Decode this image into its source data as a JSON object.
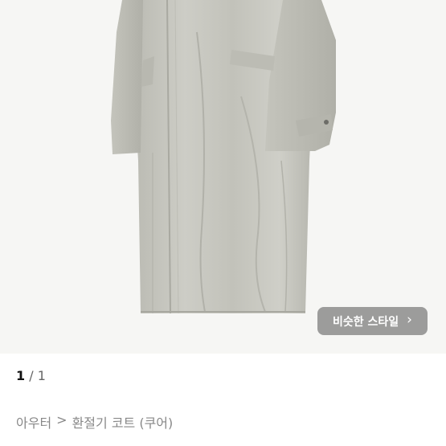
{
  "image": {
    "description_icon": "coat-photo",
    "background_color": "#f6f6f4",
    "coat_color": "#c7c7bf"
  },
  "similar_style": {
    "label": "비슷한 스타일",
    "icon": "chevron-right-icon"
  },
  "pagination": {
    "current": "1",
    "separator": "/",
    "total": "1"
  },
  "breadcrumb": {
    "category": "아우터",
    "separator": ">",
    "subcategory": "환절기 코트 (쿠어)"
  }
}
